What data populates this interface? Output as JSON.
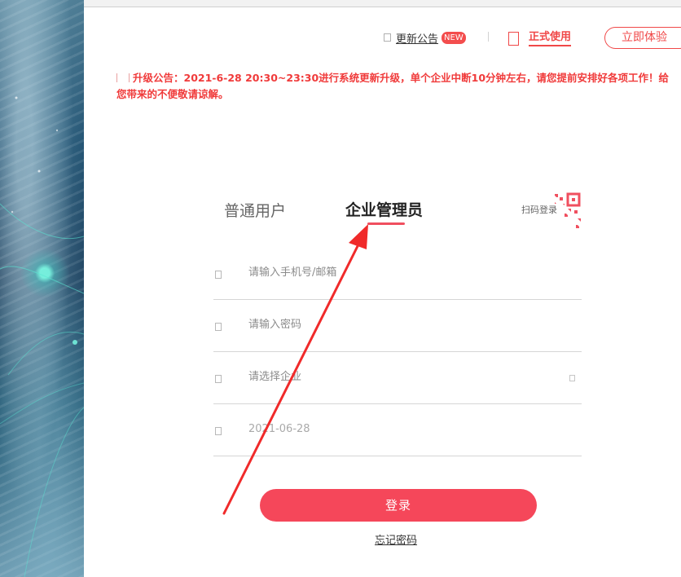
{
  "header": {
    "notice_link": "更新公告",
    "new_badge": "NEW",
    "official_label": "正式使用",
    "trial_button": "立即体验"
  },
  "announcement": {
    "text": "升级公告：2021-6-28 20:30~23:30进行系统更新升级，单个企业中断10分钟左右，请您提前安排好各项工作！给您带来的不便敬请谅解。"
  },
  "login": {
    "tabs": [
      {
        "label": "普通用户",
        "active": false
      },
      {
        "label": "企业管理员",
        "active": true
      }
    ],
    "qr_label": "扫码登录",
    "fields": {
      "phone_placeholder": "请输入手机号/邮箱",
      "password_placeholder": "请输入密码",
      "company_placeholder": "请选择企业",
      "date_value": "2021-06-28"
    },
    "submit_label": "登录",
    "forgot_label": "忘记密码"
  },
  "colors": {
    "accent": "#f5475a",
    "notice_red": "#f03a3a"
  },
  "icons": [
    "bell-icon",
    "official-icon",
    "announcement-icon",
    "qr-code-icon",
    "user-icon",
    "lock-icon",
    "building-icon",
    "dropdown-icon",
    "calendar-icon"
  ]
}
